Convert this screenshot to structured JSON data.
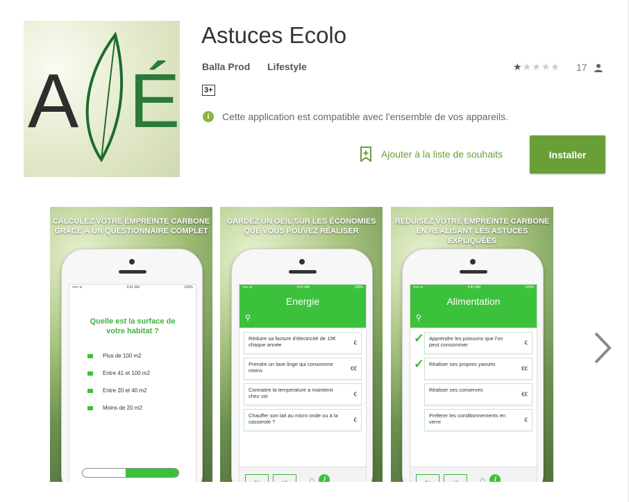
{
  "app": {
    "title": "Astuces Ecolo",
    "developer": "Balla Prod",
    "category": "Lifestyle",
    "content_rating": "3+",
    "rating_stars": 1,
    "rating_max": 5,
    "rating_count": "17",
    "compat_icon": "i",
    "compatibility": "Cette application est compatible avec l'ensemble de vos appareils.",
    "wishlist_label": "Ajouter à la liste de souhaits",
    "install_label": "Installer",
    "icon_letters": [
      "A",
      "É"
    ],
    "accent_color": "#689f38"
  },
  "screenshots": [
    {
      "caption": "CALCULEZ VOTRE EMPREINTE CARBONE GRÂCE À UN QUESTIONNAIRE COMPLET",
      "status_left": "••••• ≋",
      "status_time": "9:41 AM",
      "status_right": "100%",
      "question": "Quelle est la surface de votre habitat ?",
      "options": [
        "Plus de 100 m2",
        "Entre 41 et 100 m2",
        "Entre 20 et 40 m2",
        "Moins de 20 m2"
      ],
      "thermometer_fill": 0.55
    },
    {
      "caption": "GARDEZ UN OEIL SUR LES ÉCONOMIES QUE VOUS POUVEZ RÉALISER",
      "status_left": "••••• ≋",
      "status_time": "9:41 AM",
      "status_right": "100%",
      "header": "Energie",
      "search_icon": "⚲",
      "items": [
        {
          "text": "Réduire sa facture d'électricité de 10€ chaque année",
          "value": "€"
        },
        {
          "text": "Prendre un lave linge qui consomme moins",
          "value": "€€"
        },
        {
          "text": "Connaitre la temperature a maintenir chez soi",
          "value": "€"
        },
        {
          "text": "Chauffer son lait au micro onde ou à la casserole ?",
          "value": "€"
        }
      ],
      "nav": {
        "prev": "←",
        "next": "→",
        "home": "⌂",
        "info": "i"
      }
    },
    {
      "caption": "REDUISEZ VOTRE EMPREINTE CARBONE EN RÉALISANT LES ASTUCES EXPLIQUÉES",
      "status_left": "••••• ≋",
      "status_time": "9:41 AM",
      "status_right": "100%",
      "header": "Alimentation",
      "search_icon": "⚲",
      "items": [
        {
          "text": "Apprendre les poissons que l'on peut consommer",
          "value": "€",
          "checked": true
        },
        {
          "text": "Réaliser ses propres yaourts",
          "value": "€€",
          "checked": true
        },
        {
          "text": "Réaliser ses conserves",
          "value": "€€",
          "checked": false
        },
        {
          "text": "Preferer les conditionnements en verre",
          "value": "€",
          "checked": false
        }
      ],
      "nav": {
        "prev": "←",
        "next": "→",
        "home": "⌂",
        "info": "i"
      }
    }
  ]
}
